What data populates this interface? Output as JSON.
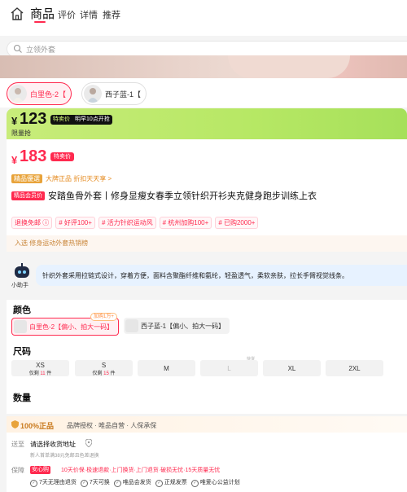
{
  "nav": {
    "tabs": [
      {
        "label": "商品",
        "active": true
      },
      {
        "label": "评价"
      },
      {
        "label": "详情"
      },
      {
        "label": "推荐"
      }
    ]
  },
  "search": {
    "placeholder": "立领外套"
  },
  "thumbs": [
    {
      "label": "白里色-2【",
      "selected": true
    },
    {
      "label": "西子蓝-1【",
      "selected": false
    }
  ],
  "price_band": {
    "currency": "¥",
    "price": "123",
    "badge_left": "特卖价",
    "badge_right": "明早10点开抢",
    "sub": "限量抢"
  },
  "price_main": {
    "currency": "¥",
    "price": "183",
    "badge": "特卖价"
  },
  "guarantee": {
    "tag": "精品優選",
    "text": "大牌正品 折扣天天享 >"
  },
  "product": {
    "tag": "精品会员价",
    "title": "安踏鱼骨外套丨修身显瘦女春季立领针织开衫夹克健身跑步训练上衣"
  },
  "chips": [
    "退换免邮 ⓘ",
    "# 好评100+",
    "# 活力针织运动风",
    "# 杭州加购100+",
    "# 已购2000+"
  ],
  "ranking": {
    "text": "入选 修身运动外套热销榜"
  },
  "assistant": {
    "label": "小助手",
    "text": "针织外套采用拉链式设计，穿着方便，面料含聚酯纤维和氨纶，轻盈透气，柔软亲肤，拉长手臂视觉线条。"
  },
  "spec": {
    "color_heading": "颜色",
    "colors": [
      {
        "label": "白里色-2【偏小、拍大一码】",
        "selected": true
      },
      {
        "label": "西子蓝-1【偏小、拍大一码】",
        "selected": false
      }
    ],
    "color_bubble": "加购1万+",
    "size_heading": "尺码",
    "sizes": [
      {
        "name": "XS",
        "stock_prefix": "仅剩",
        "stock": "11",
        "stock_suffix": "件"
      },
      {
        "name": "S",
        "stock_prefix": "仅剩",
        "stock": "15",
        "stock_suffix": "件"
      },
      {
        "name": "M"
      },
      {
        "name": "L"
      },
      {
        "name": "XL"
      },
      {
        "name": "2XL"
      }
    ],
    "soon_label": "快货",
    "qty_heading": "数量"
  },
  "service": {
    "brand": "100%正品",
    "brand_desc": "品牌授权 · 唯品自营 · 人保承保",
    "ship_label": "送至",
    "ship_value": "请选择收货地址",
    "ship_sub": "新人首单满38元免邮且色差退换",
    "guarantee_label": "保障",
    "guarantee_tag": "安心购",
    "guarantee_text": "10天价保·极速退款·上门换货·上门退货·破损无忧·15天质量无忧",
    "items": [
      "7天无理由退货",
      "7天可换",
      "唯品会发货",
      "正规发票",
      "唯爱心公益计划"
    ]
  },
  "colors": {
    "accent": "#ff2a4f",
    "lime": "#b7e865",
    "gold": "#c97a1e",
    "assistant_bg": "#e7f2ff"
  }
}
